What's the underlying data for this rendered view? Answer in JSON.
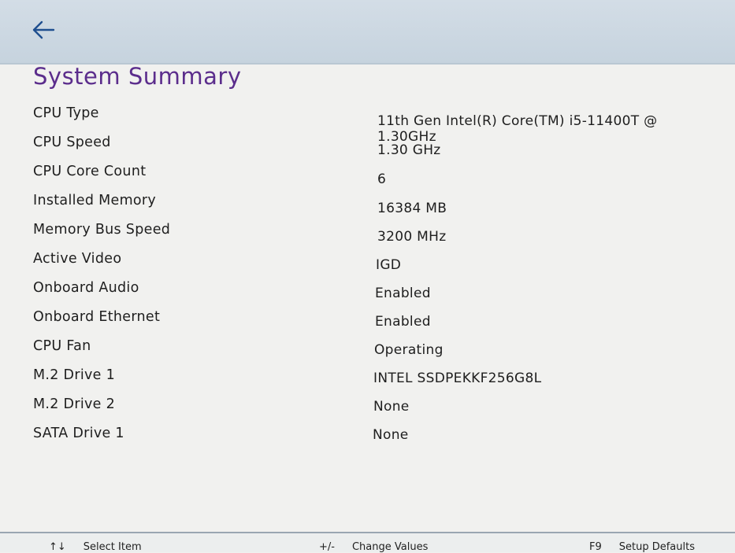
{
  "header": {
    "back_icon": "arrow-left-icon"
  },
  "page": {
    "title": "System Summary"
  },
  "summary": {
    "rows": [
      {
        "label": "CPU Type",
        "value": "11th Gen Intel(R) Core(TM) i5-11400T @ 1.30GHz"
      },
      {
        "label": "CPU Speed",
        "value": "1.30 GHz"
      },
      {
        "label": "CPU Core Count",
        "value": "6"
      },
      {
        "label": "Installed Memory",
        "value": "16384 MB"
      },
      {
        "label": "Memory Bus Speed",
        "value": "3200 MHz"
      },
      {
        "label": "Active Video",
        "value": "IGD"
      },
      {
        "label": "Onboard Audio",
        "value": "Enabled"
      },
      {
        "label": "Onboard Ethernet",
        "value": "Enabled"
      },
      {
        "label": "CPU Fan",
        "value": "Operating"
      },
      {
        "label": "M.2 Drive 1",
        "value": "INTEL SSDPEKKF256G8L"
      },
      {
        "label": "M.2 Drive 2",
        "value": "None"
      },
      {
        "label": "SATA Drive 1",
        "value": "None"
      }
    ]
  },
  "footer": {
    "hints": [
      {
        "key": "↑↓",
        "label": "Select Item"
      },
      {
        "key": "+/-",
        "label": "Change Values"
      },
      {
        "key": "F9",
        "label": "Setup Defaults"
      }
    ]
  },
  "colors": {
    "title": "#5b2d8c",
    "back_icon": "#1f4f8f",
    "top_bar": "#c6d3de"
  }
}
